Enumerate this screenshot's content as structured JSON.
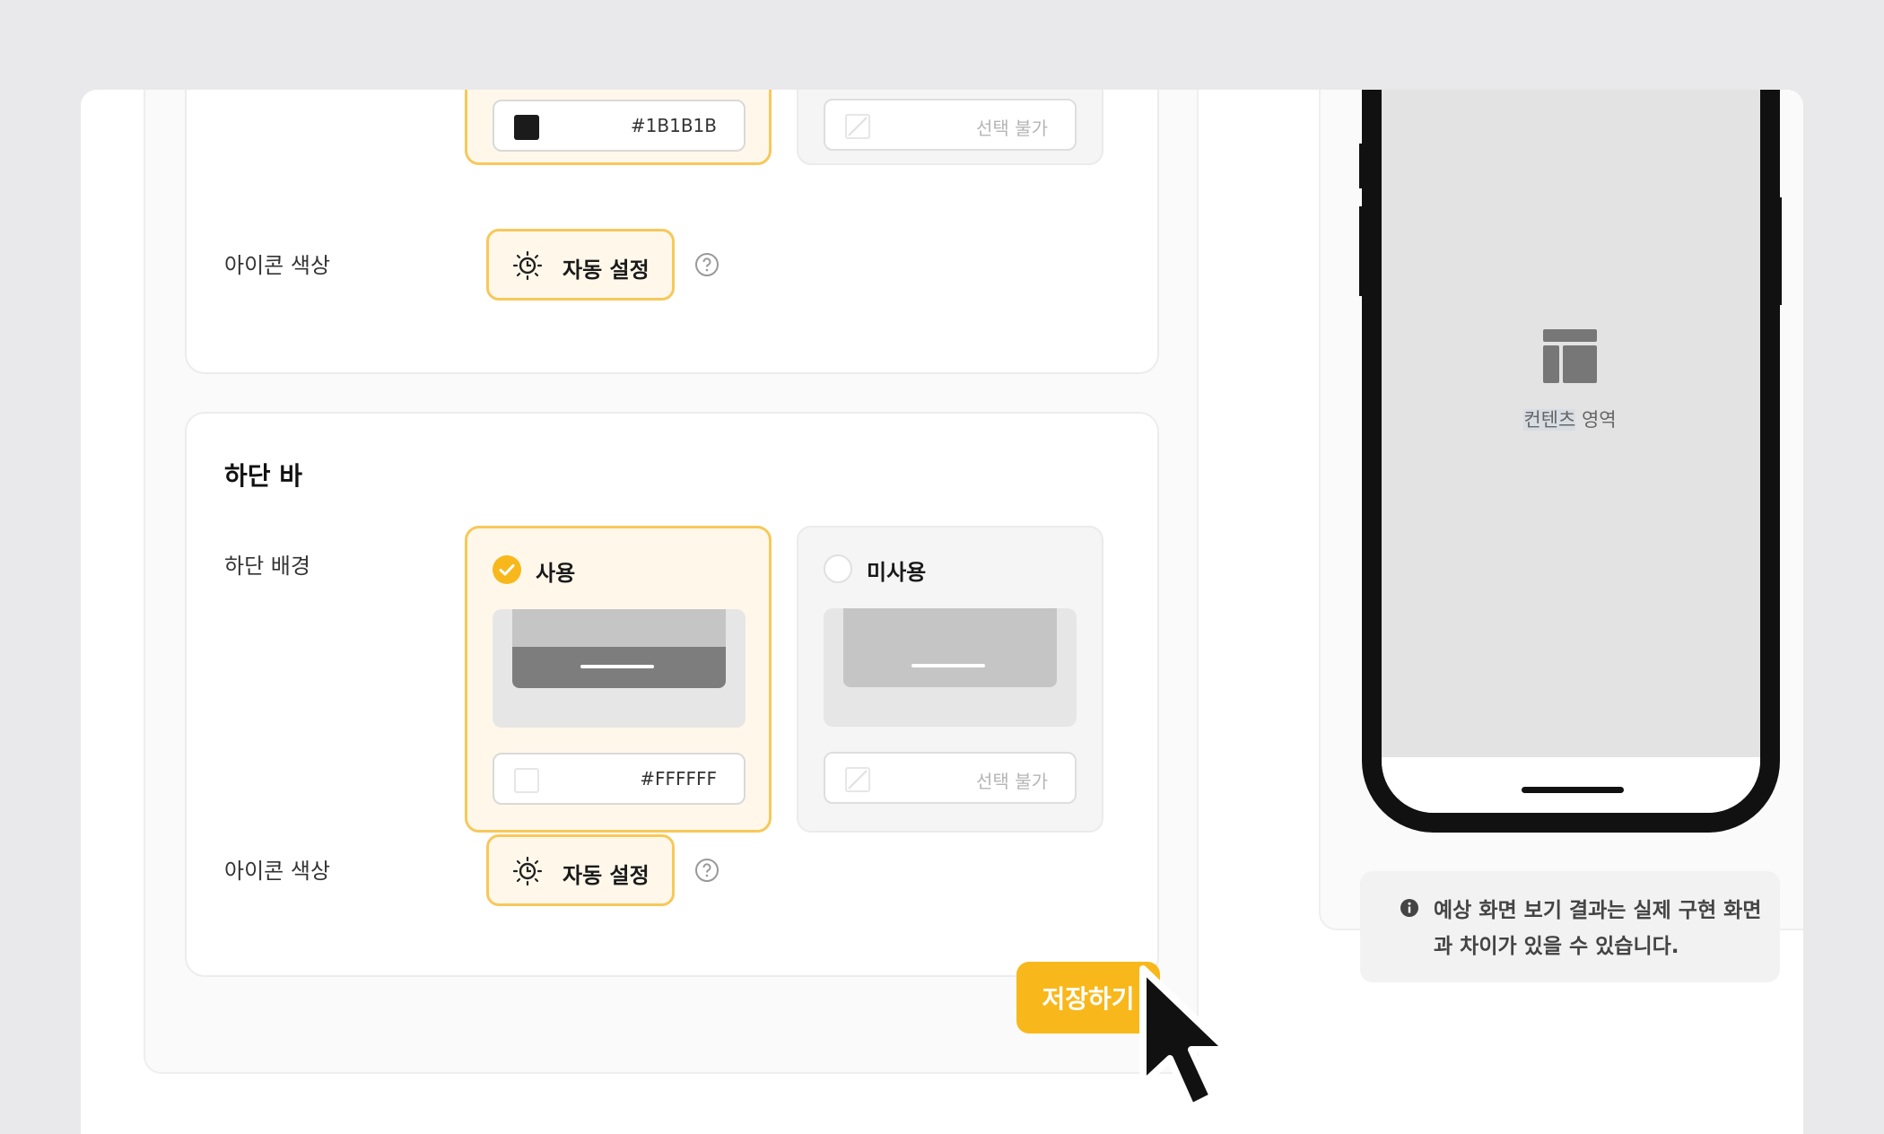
{
  "top_section": {
    "color_selected_value": "#1B1B1B",
    "color_disabled_value": "선택 불가",
    "icon_color_label": "아이콘 색상",
    "auto_button_label": "자동 설정"
  },
  "bottom_section": {
    "title": "하단 바",
    "background_label": "하단 배경",
    "option_use_label": "사용",
    "option_unused_label": "미사용",
    "color_selected_value": "#FFFFFF",
    "color_disabled_value": "선택 불가",
    "icon_color_label": "아이콘 색상",
    "auto_button_label": "자동 설정"
  },
  "save_button_label": "저장하기",
  "preview": {
    "content_label_highlight": "컨텐츠",
    "content_label_rest": " 영역",
    "notice_text": "예상 화면 보기 결과는 실제 구현 화면과 차이가 있을 수 있습니다."
  },
  "colors": {
    "accent": "#F8B81C",
    "accent_border": "#F7C85A",
    "accent_bg": "#FFF8EA"
  },
  "icons": [
    "sun-auto-icon",
    "help-icon",
    "check-icon",
    "layout-icon",
    "info-icon",
    "cursor-icon"
  ]
}
